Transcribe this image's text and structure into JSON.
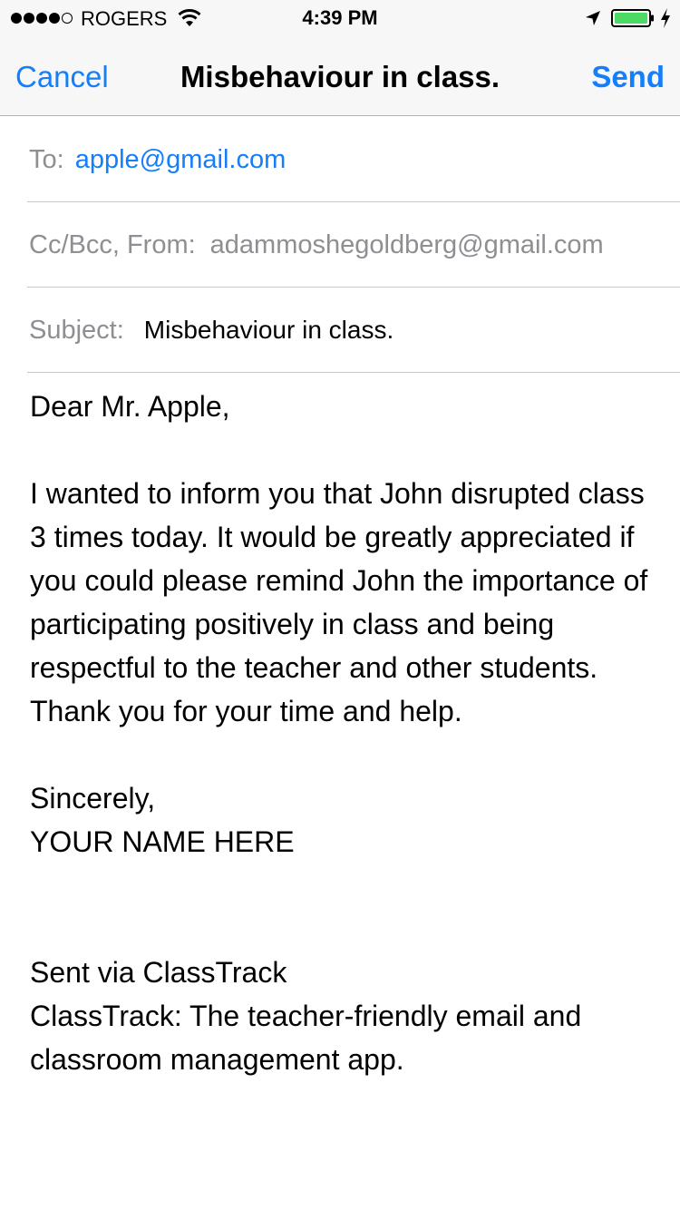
{
  "status_bar": {
    "carrier": "ROGERS",
    "time": "4:39 PM",
    "signal_bars_filled": 4,
    "signal_bars_total": 5,
    "battery_color": "#4cd964"
  },
  "nav": {
    "cancel_label": "Cancel",
    "title": "Misbehaviour in class.",
    "send_label": "Send"
  },
  "compose": {
    "to_label": "To:",
    "to_value": "apple@gmail.com",
    "ccbcc_label": "Cc/Bcc, From:",
    "from_value": "adammoshegoldberg@gmail.com",
    "subject_label": "Subject:",
    "subject_value": "Misbehaviour in class."
  },
  "body": {
    "greeting": "Dear Mr. Apple,",
    "message": "I wanted to inform you that John disrupted class 3 times today. It would be greatly appreciated if you could please remind John the importance of participating positively in class and being respectful to the teacher and other students. Thank you for your time and help.",
    "closing": "Sincerely,",
    "signature": "YOUR NAME HERE",
    "footer_line1": "Sent via ClassTrack",
    "footer_line2": "ClassTrack: The teacher-friendly email and classroom management app."
  },
  "colors": {
    "accent": "#147efb",
    "label_gray": "#8e8e93",
    "bar_background": "#f7f7f7"
  }
}
